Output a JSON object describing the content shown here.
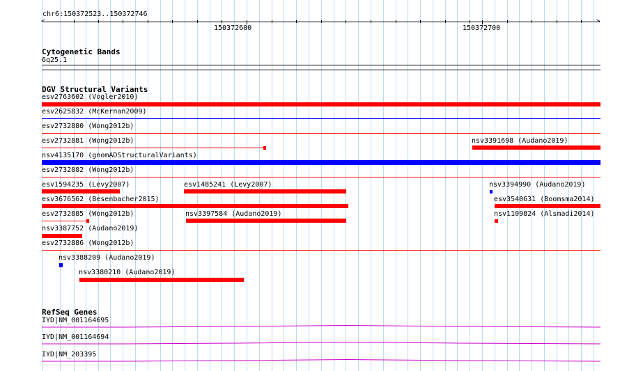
{
  "ruler": {
    "location": "chr6:150372523..150372746",
    "major_labels": [
      "150372600",
      "150372700"
    ]
  },
  "tracks": {
    "cytogenetic": {
      "title": "Cytogenetic Bands",
      "band": "6q25.1"
    },
    "dgv": {
      "title": "DGV Structural Variants"
    },
    "refseq": {
      "title": "RefSeq Genes"
    }
  },
  "dgv_items": [
    "esv2763602 (Vogler2010)",
    "esv2625832 (McKernan2009)",
    "esv2732880 (Wong2012b)",
    "esv2732881 (Wong2012b)",
    "nsv3391698 (Audano2019)",
    "nsv4135170 (gnomADStructuralVariants)",
    "esv2732882 (Wong2012b)",
    "esv1594235 (Levy2007)",
    "esv1485241 (Levy2007)",
    "nsv3394990 (Audano2019)",
    "esv3676562 (Besenbacher2015)",
    "esv3540631 (Boomsma2014)",
    "esv2732885 (Wong2012b)",
    "nsv3397584 (Audano2019)",
    "nsv1109824 (Alsmadi2014)",
    "nsv3387752 (Audano2019)",
    "esv2732886 (Wong2012b)",
    "nsv3388209 (Audano2019)",
    "nsv3380210 (Audano2019)"
  ],
  "genes": [
    "IYD|NM_001164695",
    "IYD|NM_001164694",
    "IYD|NM_203395"
  ],
  "colors": {
    "grid": "#b9dcee",
    "loss": "#ff0000",
    "gain": "#0000ff",
    "gene": "#cc00cc",
    "outline": "#000000"
  }
}
